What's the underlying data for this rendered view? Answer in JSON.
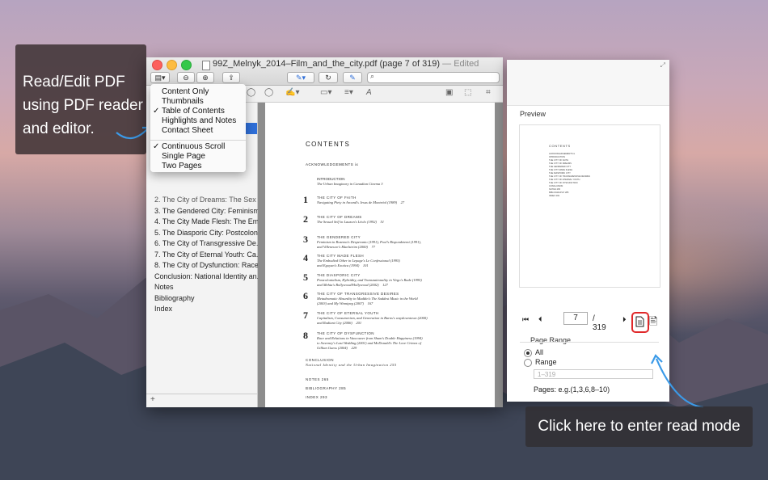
{
  "captions": {
    "left": "Read/Edit PDF\nusing PDF reader\nand editor.",
    "right": "Click here to enter read mode"
  },
  "window": {
    "title": "99Z_Melnyk_2014–Film_and_the_city.pdf (page 7 of 319)",
    "edited": "— Edited",
    "search_placeholder": ""
  },
  "view_menu": {
    "items": [
      {
        "label": "Content Only",
        "checked": false
      },
      {
        "label": "Thumbnails",
        "checked": false
      },
      {
        "label": "Table of Contents",
        "checked": true
      },
      {
        "label": "Highlights and Notes",
        "checked": false
      },
      {
        "label": "Contact Sheet",
        "checked": false
      },
      {
        "label": "Continuous Scroll",
        "checked": true
      },
      {
        "label": "Single Page",
        "checked": false
      },
      {
        "label": "Two Pages",
        "checked": false
      }
    ]
  },
  "sidebar": {
    "toc": [
      "3. The Gendered City: Feminism...",
      "4. The City Made Flesh: The Em...",
      "5. The Diasporic City: Postcolon...",
      "6. The City of Transgressive De...",
      "7. The City of Eternal Youth: Ca...",
      "8. The City of Dysfunction: Race...",
      "Conclusion: National Identity an...",
      "Notes",
      "Bibliography",
      "Index"
    ],
    "partial_item": "2. The City of Dreams: The Sex",
    "add_label": "+"
  },
  "page": {
    "title": "CONTENTS",
    "ack": "ACKNOWLEDGEMENTS   ix",
    "intro_title": "INTRODUCTION",
    "intro_sub": "The Urban Imaginary in Canadian Cinema    3",
    "chapters": [
      {
        "num": "1",
        "title": "THE CITY OF FAITH",
        "sub": "Navigating Piety in Arcand's Jesus de Montréal (1989)    27"
      },
      {
        "num": "2",
        "title": "THE CITY OF DREAMS",
        "sub": "The Sexual Self in Lauzon's Léolo (1992)    51"
      },
      {
        "num": "3",
        "title": "THE GENDERED CITY",
        "sub": "Feminism in Rozema's Desperanto (1991), Pool's Rispondetemi (1991),\nand Villeneuve's Maelström (2000)    77"
      },
      {
        "num": "4",
        "title": "THE CITY MADE FLESH",
        "sub": "The Embodied Other in Lepage's Le Confessional (1995)\nand Egoyan's Exotica (1994)    101"
      },
      {
        "num": "5",
        "title": "THE DIASPORIC CITY",
        "sub": "Postcolonialism, Hybridity, and Transnationality in Virgo's Rude (1995)\nand Mehta's Bollywood/Hollywood (2002)    127"
      },
      {
        "num": "6",
        "title": "THE CITY OF TRANSGRESSIVE DESIRES",
        "sub": "Metadramatic Absurdity in Maddin's The Saddest Music in the World\n(2003) and My Winnipeg (2007)    167"
      },
      {
        "num": "7",
        "title": "THE CITY OF ETERNAL YOUTH",
        "sub": "Capitalism, Consumerism, and Generation in Burns's waydowntown (2000)\nand Radiant City (2006)    201"
      },
      {
        "num": "8",
        "title": "THE CITY OF DYSFUNCTION",
        "sub": "Race and Relations in Vancouver from Shum's Double Happiness (1994)\nto Sweeney's Last Wedding (2001) and McDonald's The Love Crimes of\nGillian Guess (2004)    229"
      }
    ],
    "conclusion_title": "CONCLUSION",
    "conclusion_sub": "National Identity and the Urban Imagination    255",
    "notes": "NOTES    265",
    "bibliography": "BIBLIOGRAPHY    285",
    "index": "INDEX    293"
  },
  "panel": {
    "preview_label": "Preview",
    "current_page": "7",
    "of_pages": "/ 319",
    "range_title": "Page Range",
    "opt_all": "All",
    "opt_range": "Range",
    "range_placeholder": "1–319",
    "pages_example": "Pages: e.g.(1,3,6,8–10)"
  },
  "colors": {
    "accent": "#2f6fd8",
    "read_button_outline": "#e0282a",
    "arrow": "#3b9ae8"
  }
}
